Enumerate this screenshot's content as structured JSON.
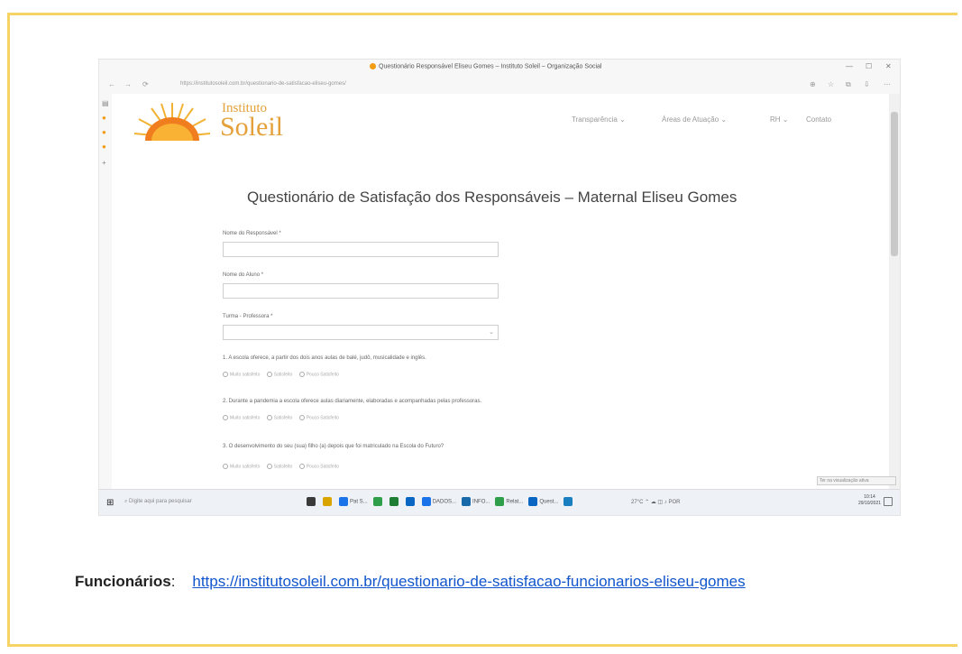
{
  "browser": {
    "window_title": "Questionário Responsável Eliseu Gomes – Instituto Soleil – Organização Social",
    "url": "https://institutosoleil.com.br/questionario-de-satisfacao-eliseu-gomes/",
    "window_controls": [
      "—",
      "☐",
      "✕"
    ],
    "nav_buttons": [
      "←",
      "→",
      "⟳"
    ],
    "toolbar_icons": [
      "⊕",
      "☆",
      "⧉",
      "⇩",
      "⋯"
    ]
  },
  "site": {
    "brand_top": "Instituto",
    "brand_main": "Soleil",
    "nav": [
      "Transparência ⌄",
      "Áreas de Atuação ⌄",
      "RH ⌄",
      "Contato"
    ]
  },
  "form": {
    "title": "Questionário de Satisfação dos Responsáveis – Maternal Eliseu Gomes",
    "fields": [
      {
        "label": "Nome do Responsável *"
      },
      {
        "label": "Nome do Aluno *"
      }
    ],
    "select": {
      "label": "Turma - Professora *",
      "value": ""
    },
    "questions": [
      {
        "text": "1. A escola oferece, a partir dos dois anos aulas de balé, judô, musicalidade e inglês.",
        "options": [
          "Muito satisfeito",
          "Satisfeito",
          "Pouco Satisfeito"
        ]
      },
      {
        "text": "2. Durante a pandemia a escola oferece aulas diariamente, elaboradas e acompanhadas pelas professoras.",
        "options": [
          "Muito satisfeito",
          "Satisfeito",
          "Pouco Satisfeito"
        ]
      },
      {
        "text": "3. O desenvolvimento do seu (sua) filho (a) depois que foi matriculado na Escola do Futuro?",
        "options": [
          "Muito satisfeito",
          "Satisfeito",
          "Pouco Satisfeito"
        ]
      }
    ]
  },
  "tooltip": "Ter na visualização ativa",
  "taskbar": {
    "start_icon": "⊞",
    "search_placeholder": "Digite aqui para pesquisar",
    "apps": [
      {
        "label": "",
        "color": "#3a3a3a"
      },
      {
        "label": "",
        "color": "#d9a400"
      },
      {
        "label": "Pat S...",
        "color": "#1a73e8"
      },
      {
        "label": "",
        "color": "#2e9e4a"
      },
      {
        "label": "",
        "color": "#1e7e34"
      },
      {
        "label": "",
        "color": "#0a66c2"
      },
      {
        "label": "DADOS...",
        "color": "#1a73e8"
      },
      {
        "label": "INFO...",
        "color": "#1769aa"
      },
      {
        "label": "Relat...",
        "color": "#2e9e4a"
      },
      {
        "label": "Quest...",
        "color": "#0a66c2"
      },
      {
        "label": "",
        "color": "#1a7fc1"
      }
    ],
    "tray": "27°C  ⌃  ☁  ◫  ♪  POR",
    "clock_time": "10:14",
    "clock_date": "29/10/2021"
  },
  "footer": {
    "label": "Funcionários",
    "separator": ":",
    "link": "https://institutosoleil.com.br/questionario-de-satisfacao-funcionarios-eliseu-gomes"
  },
  "colors": {
    "frame_border": "#f6d365",
    "brand": "#e4a13a",
    "link": "#1155cc"
  }
}
